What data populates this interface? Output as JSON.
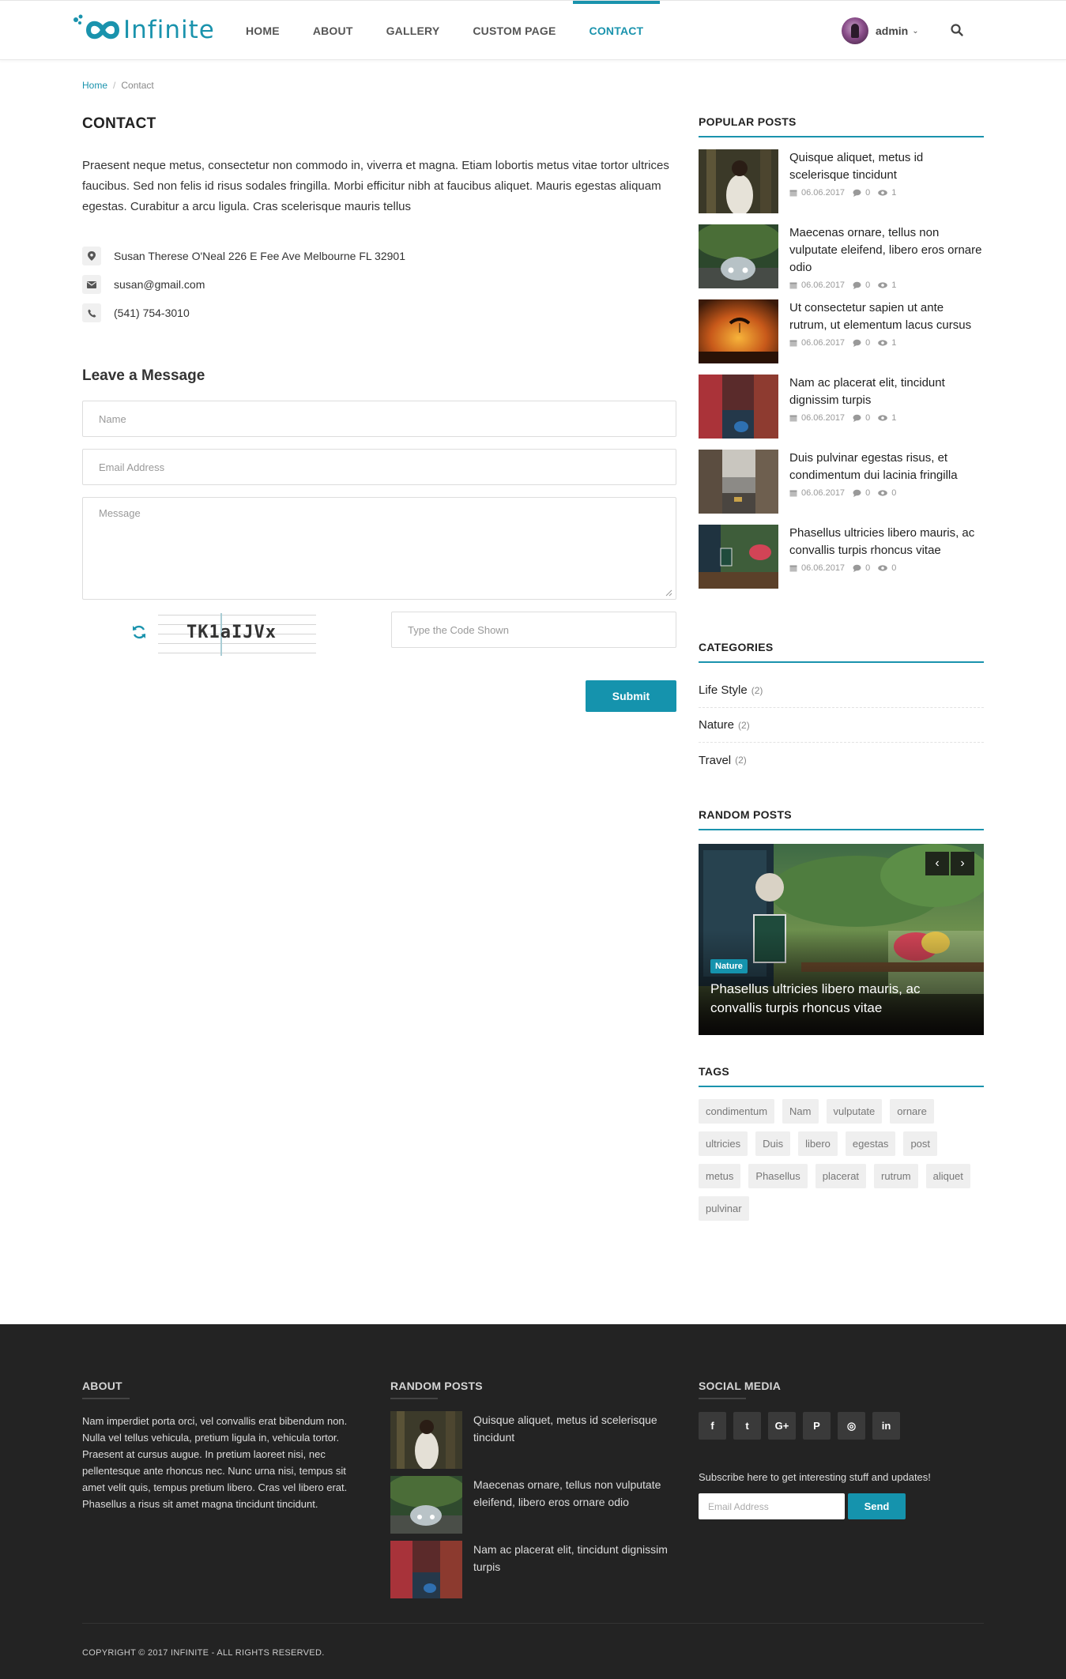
{
  "header": {
    "logo_text": "Infinite",
    "nav": [
      "HOME",
      "ABOUT",
      "GALLERY",
      "CUSTOM PAGE",
      "CONTACT"
    ],
    "active_nav": "CONTACT",
    "user_name": "admin"
  },
  "breadcrumb": {
    "home": "Home",
    "current": "Contact"
  },
  "contact": {
    "title": "CONTACT",
    "intro": "Praesent neque metus, consectetur non commodo in, viverra et magna. Etiam lobortis metus vitae tortor ultrices faucibus. Sed non felis id risus sodales fringilla. Morbi efficitur nibh at faucibus aliquet. Mauris egestas aliquam egestas. Curabitur a arcu ligula. Cras scelerisque mauris tellus",
    "address": "Susan Therese O'Neal 226 E Fee Ave Melbourne FL 32901",
    "email": "susan@gmail.com",
    "phone": "(541) 754-3010"
  },
  "form": {
    "title": "Leave a Message",
    "name_placeholder": "Name",
    "email_placeholder": "Email Address",
    "message_placeholder": "Message",
    "captcha_code": "TK1aIJVx",
    "code_placeholder": "Type the Code Shown",
    "submit_label": "Submit"
  },
  "sidebar": {
    "popular_heading": "POPULAR POSTS",
    "popular_posts": [
      {
        "title": "Quisque aliquet, metus id scelerisque tincidunt",
        "date": "06.06.2017",
        "comments": "0",
        "views": "1",
        "thumb": "forest-girl"
      },
      {
        "title": "Maecenas ornare, tellus non vulputate eleifend, libero eros ornare odio",
        "date": "06.06.2017",
        "comments": "0",
        "views": "1",
        "thumb": "car-forest"
      },
      {
        "title": "Ut consectetur sapien ut ante rutrum, ut elementum lacus cursus",
        "date": "06.06.2017",
        "comments": "0",
        "views": "1",
        "thumb": "paraglider-sunset"
      },
      {
        "title": "Nam ac placerat elit, tincidunt dignissim turpis",
        "date": "06.06.2017",
        "comments": "0",
        "views": "1",
        "thumb": "venice-canal"
      },
      {
        "title": "Duis pulvinar egestas risus, et condimentum dui lacinia fringilla",
        "date": "06.06.2017",
        "comments": "0",
        "views": "0",
        "thumb": "city-street"
      },
      {
        "title": "Phasellus ultricies libero mauris, ac convallis turpis rhoncus vitae",
        "date": "06.06.2017",
        "comments": "0",
        "views": "0",
        "thumb": "cafe-table"
      }
    ],
    "categories_heading": "CATEGORIES",
    "categories": [
      {
        "name": "Life Style",
        "count": "(2)"
      },
      {
        "name": "Nature",
        "count": "(2)"
      },
      {
        "name": "Travel",
        "count": "(2)"
      }
    ],
    "random_heading": "RANDOM POSTS",
    "random_post": {
      "badge": "Nature",
      "title": "Phasellus ultricies libero mauris, ac convallis turpis rhoncus vitae"
    },
    "tags_heading": "TAGS",
    "tags": [
      "condimentum",
      "Nam",
      "vulputate",
      "ornare",
      "ultricies",
      "Duis",
      "libero",
      "egestas",
      "post",
      "metus",
      "Phasellus",
      "placerat",
      "rutrum",
      "aliquet",
      "pulvinar"
    ]
  },
  "footer": {
    "about_heading": "ABOUT",
    "about_text": "Nam imperdiet porta orci, vel convallis erat bibendum non. Nulla vel tellus vehicula, pretium ligula in, vehicula tortor. Praesent at cursus augue. In pretium laoreet nisi, nec pellentesque ante rhoncus nec. Nunc urna nisi, tempus sit amet velit quis, tempus pretium libero. Cras vel libero erat. Phasellus a risus sit amet magna tincidunt tincidunt.",
    "random_heading": "RANDOM POSTS",
    "random_posts": [
      {
        "title": "Quisque aliquet, metus id scelerisque tincidunt"
      },
      {
        "title": "Maecenas ornare, tellus non vulputate eleifend, libero eros ornare odio"
      },
      {
        "title": "Nam ac placerat elit, tincidunt dignissim turpis"
      }
    ],
    "social_heading": "SOCIAL MEDIA",
    "social": [
      {
        "icon": "facebook-icon",
        "glyph": "f"
      },
      {
        "icon": "twitter-icon",
        "glyph": "t"
      },
      {
        "icon": "google-plus-icon",
        "glyph": "G+"
      },
      {
        "icon": "pinterest-icon",
        "glyph": "P"
      },
      {
        "icon": "instagram-icon",
        "glyph": "◎"
      },
      {
        "icon": "linkedin-icon",
        "glyph": "in"
      }
    ],
    "subscribe_text": "Subscribe here to get interesting stuff and updates!",
    "subscribe_placeholder": "Email Address",
    "subscribe_button": "Send",
    "copyright": "COPYRIGHT © 2017 INFINITE - ALL RIGHTS RESERVED."
  },
  "colors": {
    "accent": "#1a93ad",
    "footer_bg": "#232323",
    "tag_bg": "#efefef"
  }
}
